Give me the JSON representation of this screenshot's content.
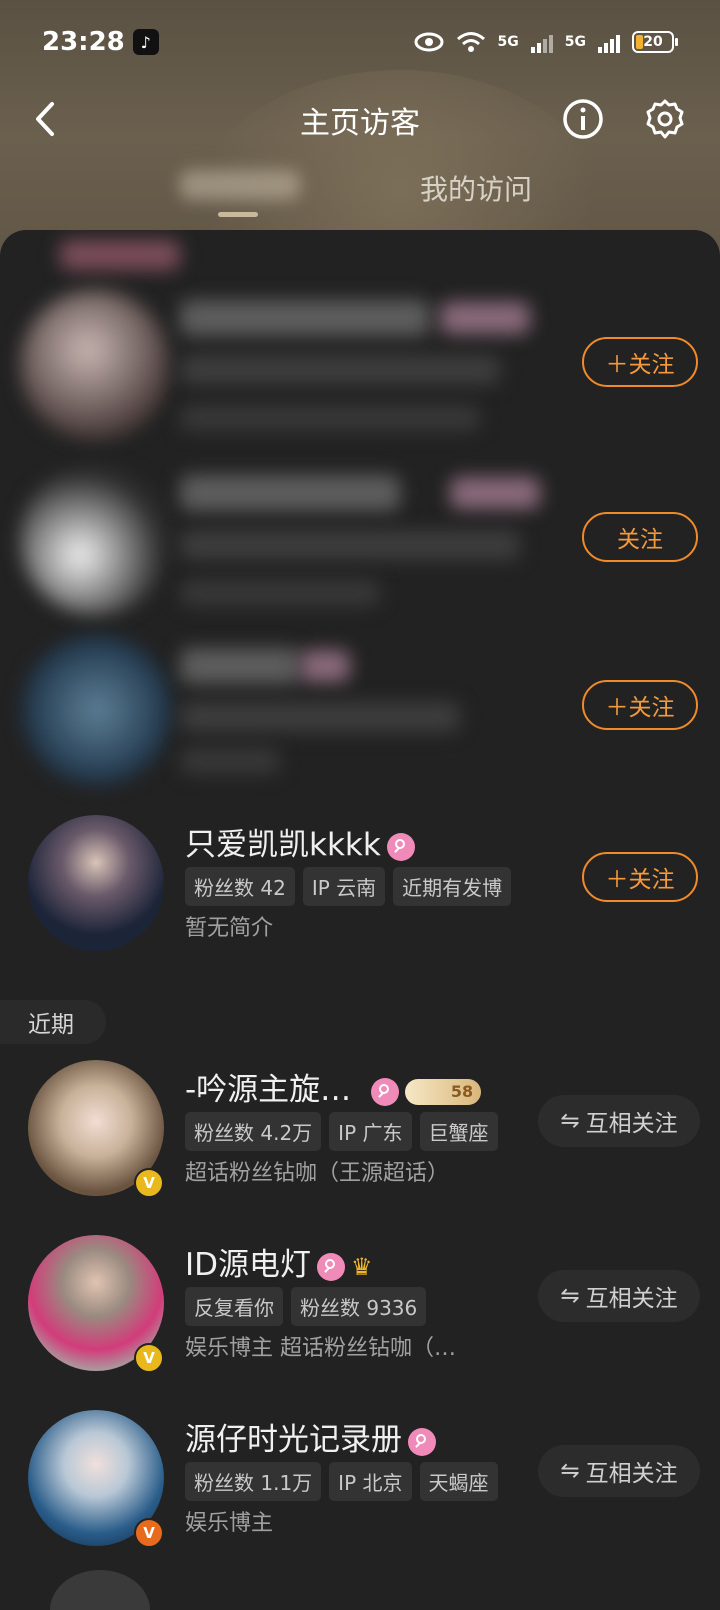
{
  "status_bar": {
    "time": "23:28",
    "tiktok_glyph": "♪",
    "net1": "5G",
    "net2": "5G",
    "battery": "20",
    "battery_level": 0.2
  },
  "nav": {
    "title": "主页访客",
    "back_icon": "back-chevron-icon",
    "info_icon": "info-icon",
    "settings_icon": "gear-icon"
  },
  "tabs": {
    "blurred_tab": "",
    "my_visits": "我的访问"
  },
  "visitors_top": [
    {
      "name": "只爱凯凯kkkk",
      "tags": [
        "粉丝数 42",
        "IP 云南",
        "近期有发博"
      ],
      "desc": "暂无简介",
      "action": "＋关注"
    }
  ],
  "blurred_follow_buttons": [
    "＋关注",
    "关注",
    "＋关注"
  ],
  "section": {
    "recent": "近期"
  },
  "recent": [
    {
      "name": "-吟源主旋…",
      "tags": [
        "粉丝数 4.2万",
        "IP 广东",
        "巨蟹座"
      ],
      "desc": "超话粉丝钻咖（王源超话）",
      "action": "互相关注",
      "badge": "V",
      "extra_badge": "58"
    },
    {
      "name": "ID源电灯",
      "tags": [
        "反复看你",
        "粉丝数 9336"
      ],
      "desc": "娱乐博主 超话粉丝钻咖（…",
      "action": "互相关注",
      "badge": "V"
    },
    {
      "name": "源仔时光记录册",
      "tags": [
        "粉丝数 1.1万",
        "IP 北京",
        "天蝎座"
      ],
      "desc": "娱乐博主",
      "action": "互相关注",
      "badge": "V"
    }
  ],
  "colors": {
    "accent_orange": "#f08a2a",
    "badge_gold": "#e8b81c",
    "badge_orange": "#e86a1c",
    "pink_badge": "#f08ab8"
  },
  "mutual_icon": "⇋"
}
